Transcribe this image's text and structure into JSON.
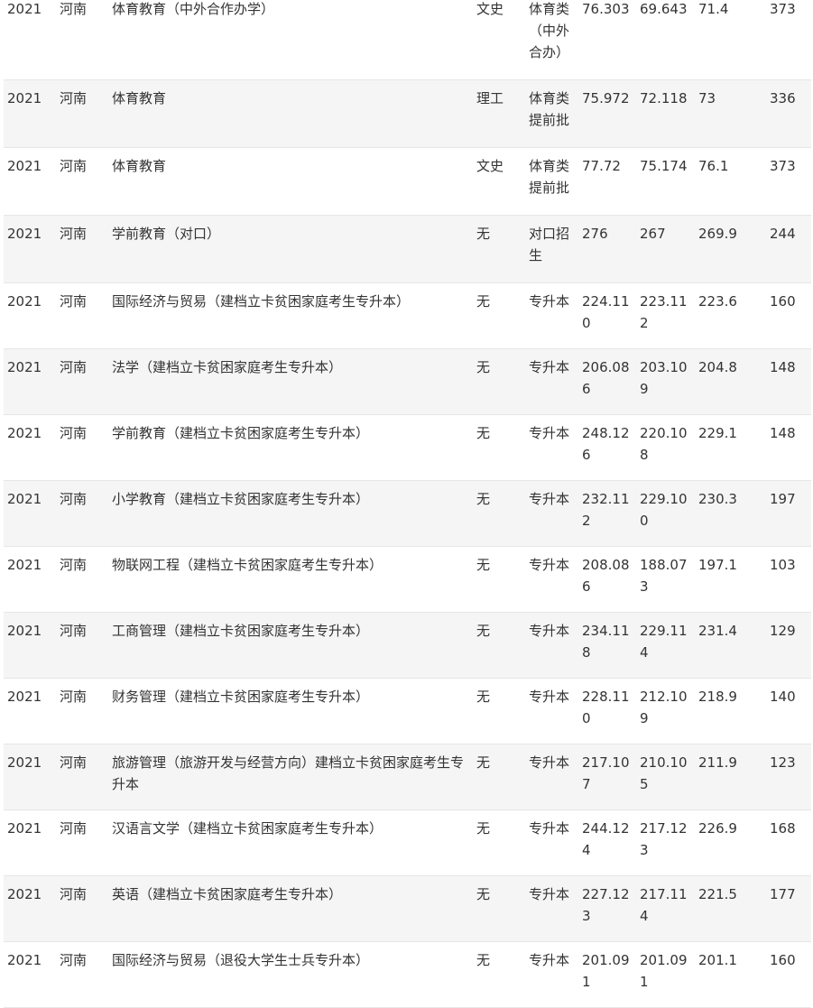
{
  "table": {
    "rows": [
      {
        "year": "2021",
        "province": "河南",
        "major": "体育教育（中外合作办学）",
        "subject": "文史",
        "batch": "体育类（中外合办）",
        "max": "76.303",
        "min": "69.643",
        "avg": "71.4",
        "control": "373"
      },
      {
        "year": "2021",
        "province": "河南",
        "major": "体育教育",
        "subject": "理工",
        "batch": "体育类提前批",
        "max": "75.972",
        "min": "72.118",
        "avg": "73",
        "control": "336"
      },
      {
        "year": "2021",
        "province": "河南",
        "major": "体育教育",
        "subject": "文史",
        "batch": "体育类提前批",
        "max": "77.72",
        "min": "75.174",
        "avg": "76.1",
        "control": "373"
      },
      {
        "year": "2021",
        "province": "河南",
        "major": "学前教育（对口）",
        "subject": "无",
        "batch": "对口招生",
        "max": "276",
        "min": "267",
        "avg": "269.9",
        "control": "244"
      },
      {
        "year": "2021",
        "province": "河南",
        "major": "国际经济与贸易（建档立卡贫困家庭考生专升本）",
        "subject": "无",
        "batch": "专升本",
        "max": "224.110",
        "min": "223.112",
        "avg": "223.6",
        "control": "160"
      },
      {
        "year": "2021",
        "province": "河南",
        "major": "法学（建档立卡贫困家庭考生专升本）",
        "subject": "无",
        "batch": "专升本",
        "max": "206.086",
        "min": "203.109",
        "avg": "204.8",
        "control": "148"
      },
      {
        "year": "2021",
        "province": "河南",
        "major": "学前教育（建档立卡贫困家庭考生专升本）",
        "subject": "无",
        "batch": "专升本",
        "max": "248.126",
        "min": "220.108",
        "avg": "229.1",
        "control": "148"
      },
      {
        "year": "2021",
        "province": "河南",
        "major": "小学教育（建档立卡贫困家庭考生专升本）",
        "subject": "无",
        "batch": "专升本",
        "max": "232.112",
        "min": "229.100",
        "avg": "230.3",
        "control": "197"
      },
      {
        "year": "2021",
        "province": "河南",
        "major": "物联网工程（建档立卡贫困家庭考生专升本）",
        "subject": "无",
        "batch": "专升本",
        "max": "208.086",
        "min": "188.073",
        "avg": "197.1",
        "control": "103"
      },
      {
        "year": "2021",
        "province": "河南",
        "major": "工商管理（建档立卡贫困家庭考生专升本）",
        "subject": "无",
        "batch": "专升本",
        "max": "234.118",
        "min": "229.114",
        "avg": "231.4",
        "control": "129"
      },
      {
        "year": "2021",
        "province": "河南",
        "major": "财务管理（建档立卡贫困家庭考生专升本）",
        "subject": "无",
        "batch": "专升本",
        "max": "228.110",
        "min": "212.109",
        "avg": "218.9",
        "control": "140"
      },
      {
        "year": "2021",
        "province": "河南",
        "major": "旅游管理（旅游开发与经营方向）建档立卡贫困家庭考生专升本",
        "subject": "无",
        "batch": "专升本",
        "max": "217.107",
        "min": "210.105",
        "avg": "211.9",
        "control": "123"
      },
      {
        "year": "2021",
        "province": "河南",
        "major": "汉语言文学（建档立卡贫困家庭考生专升本）",
        "subject": "无",
        "batch": "专升本",
        "max": "244.124",
        "min": "217.123",
        "avg": "226.9",
        "control": "168"
      },
      {
        "year": "2021",
        "province": "河南",
        "major": "英语（建档立卡贫困家庭考生专升本）",
        "subject": "无",
        "batch": "专升本",
        "max": "227.123",
        "min": "217.114",
        "avg": "221.5",
        "control": "177"
      },
      {
        "year": "2021",
        "province": "河南",
        "major": "国际经济与贸易（退役大学生士兵专升本）",
        "subject": "无",
        "batch": "专升本",
        "max": "201.091",
        "min": "201.091",
        "avg": "201.1",
        "control": "160"
      }
    ]
  }
}
